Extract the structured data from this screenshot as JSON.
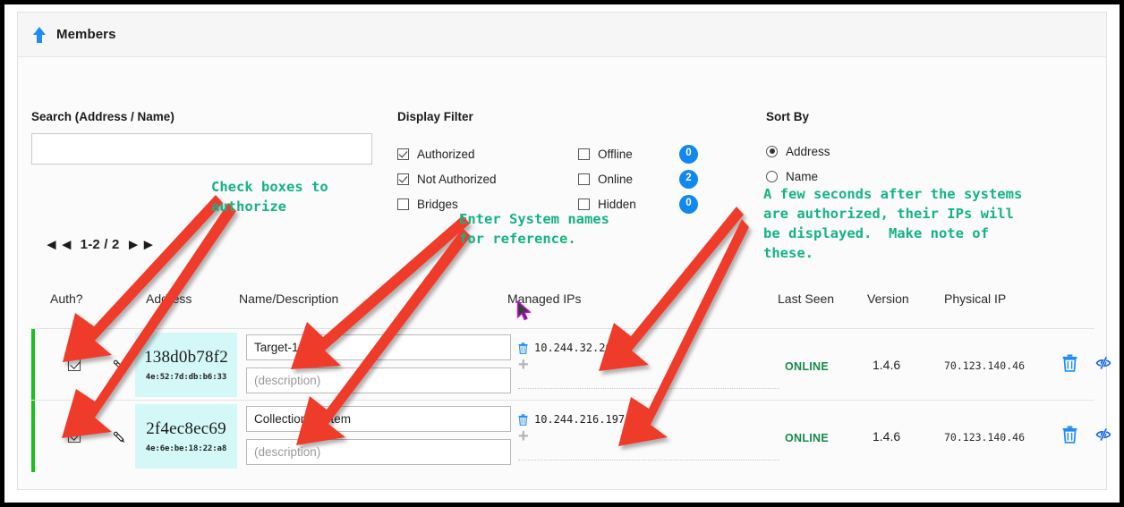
{
  "panel": {
    "title": "Members",
    "collapse_icon": "up-arrow-icon"
  },
  "search": {
    "label": "Search (Address / Name)",
    "value": "",
    "placeholder": ""
  },
  "display_filter": {
    "title": "Display Filter",
    "column_one": [
      {
        "label": "Authorized",
        "checked": true
      },
      {
        "label": "Not Authorized",
        "checked": true
      },
      {
        "label": "Bridges",
        "checked": false
      }
    ],
    "column_two": [
      {
        "label": "Offline",
        "checked": false,
        "count": "0"
      },
      {
        "label": "Online",
        "checked": false,
        "count": "2"
      },
      {
        "label": "Hidden",
        "checked": false,
        "count": "0"
      }
    ]
  },
  "sort_by": {
    "title": "Sort By",
    "options": [
      {
        "label": "Address",
        "selected": true
      },
      {
        "label": "Name",
        "selected": false
      }
    ]
  },
  "pagination": {
    "first_icon": "double-chevron-left-icon",
    "range": "1-2 / 2",
    "last_icon": "double-chevron-right-icon"
  },
  "table": {
    "headers": {
      "auth": "Auth?",
      "address": "Address",
      "name": "Name/Description",
      "managed_ips": "Managed IPs",
      "last_seen": "Last Seen",
      "version": "Version",
      "physical_ip": "Physical IP"
    },
    "rows": [
      {
        "authorized": true,
        "node_id": "138d0b78f2",
        "mac": "4e:52:7d:db:b6:33",
        "name": "Target-1",
        "description": "",
        "description_placeholder": "(description)",
        "managed_ip": "10.244.32.26",
        "last_seen": "ONLINE",
        "version": "1.4.6",
        "physical_ip": "70.123.140.46",
        "delete_icon": "trash-icon",
        "hide_icon": "eye-slash-icon",
        "edit_icon": "pencil-icon",
        "add_ip_icon": "plus-icon"
      },
      {
        "authorized": true,
        "node_id": "2f4ec8ec69",
        "mac": "4e:6e:be:18:22:a8",
        "name": "Collection System",
        "description": "",
        "description_placeholder": "(description)",
        "managed_ip": "10.244.216.197",
        "last_seen": "ONLINE",
        "version": "1.4.6",
        "physical_ip": "70.123.140.46",
        "delete_icon": "trash-icon",
        "hide_icon": "eye-slash-icon",
        "edit_icon": "pencil-icon",
        "add_ip_icon": "plus-icon"
      }
    ]
  },
  "annotations": [
    {
      "id": "check-boxes",
      "text": "Check boxes to\nauthorize"
    },
    {
      "id": "enter-names",
      "text": "Enter System names\nfor reference."
    },
    {
      "id": "ips-displayed",
      "text": "A few seconds after the systems\nare authorized, their IPs will\nbe displayed.  Make note of\nthese."
    }
  ],
  "colors": {
    "annotation_text": "#15b286",
    "arrow": "#ef3b2c",
    "badge": "#1187f0",
    "online": "#178a49",
    "row_marker": "#16c216",
    "address_cell": "#d4f8f8",
    "icon_blue": "#1f8cf5"
  }
}
